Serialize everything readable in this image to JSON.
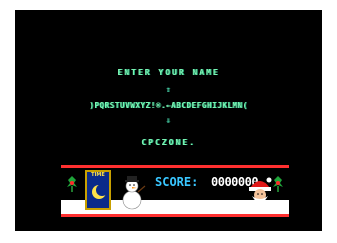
{
  "screen": {
    "prompt": "ENTER YOUR NAME",
    "arrow_up": "⇧",
    "alphabet": ")PQRSTUVWXYZ!®.←ABCDEFGHIJKLMN(",
    "arrow_down": "⇩",
    "name_entry": "CPCZONE."
  },
  "status": {
    "time_label": "TIME",
    "score_label": "SCORE",
    "score_separator": ":",
    "score_value": "0000000"
  },
  "colors": {
    "text": "#7cf5b4",
    "score_label": "#39c6ff",
    "border": "#ff3030"
  },
  "icons": [
    "holly-icon",
    "moon-icon",
    "snowman-icon",
    "santa-icon"
  ]
}
